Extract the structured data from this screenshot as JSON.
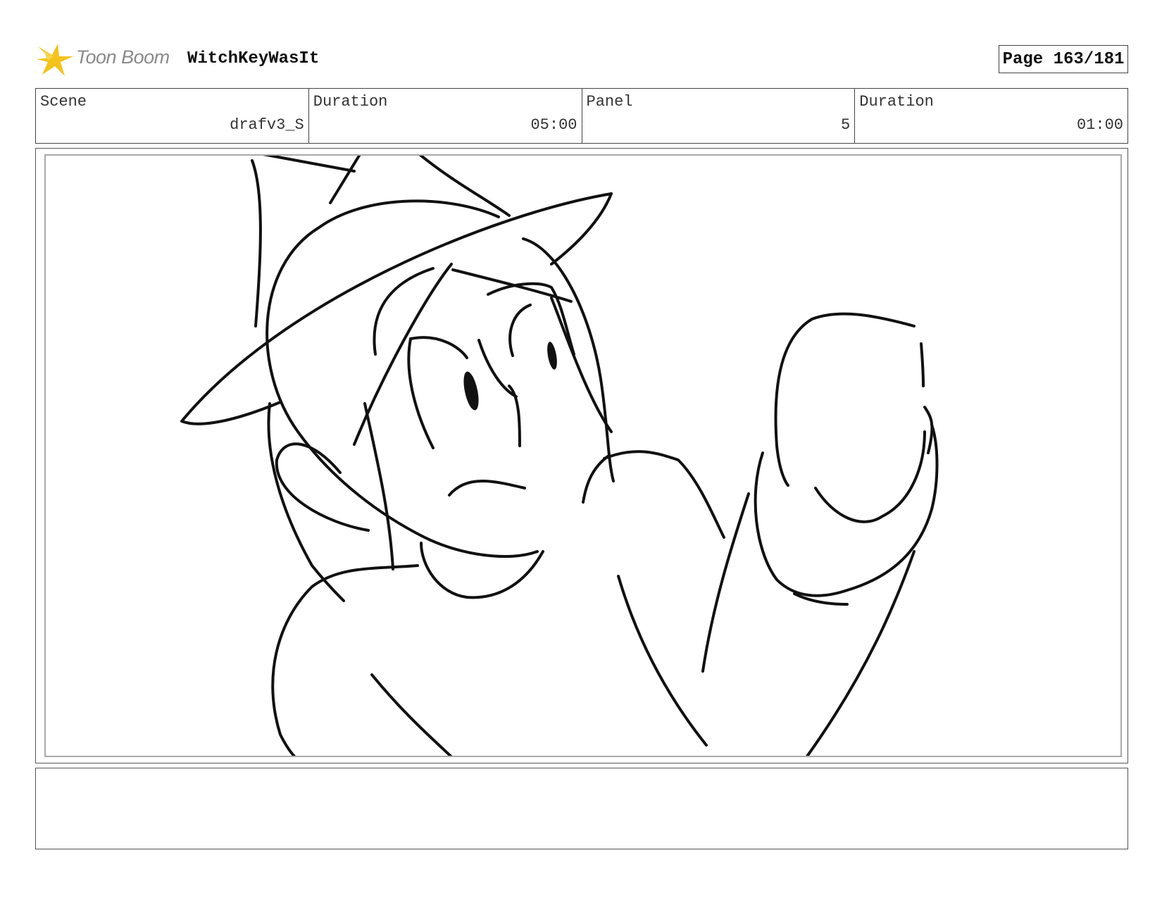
{
  "header": {
    "logo_text": "Toon Boom",
    "project_title": "WitchKeyWasIt",
    "page_label": "Page 163/181"
  },
  "info": {
    "scene_label": "Scene",
    "scene_value": "drafv3_S",
    "scene_duration_label": "Duration",
    "scene_duration_value": "05:00",
    "panel_label": "Panel",
    "panel_value": "5",
    "panel_duration_label": "Duration",
    "panel_duration_value": "01:00"
  },
  "notes": {
    "text": ""
  },
  "colors": {
    "logo_star": "#f5c21b",
    "logo_text": "#8a8a8a",
    "border": "#444444"
  },
  "icons": {
    "logo": "toon-boom-star-icon"
  }
}
